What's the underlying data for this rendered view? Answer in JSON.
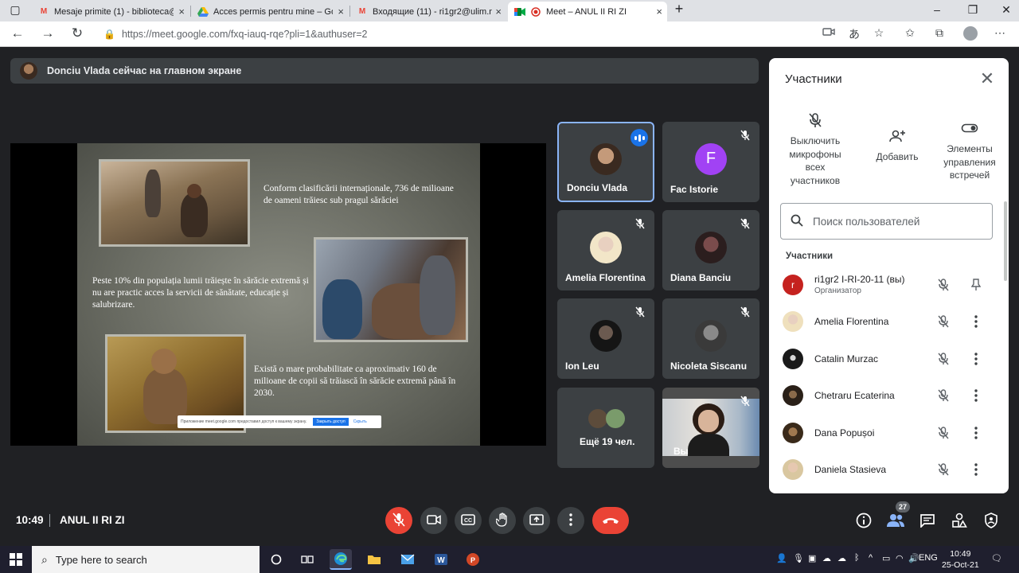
{
  "browser": {
    "tabs": [
      {
        "title": "Mesaje primite (1) - biblioteca@",
        "icon": "gmail-icon"
      },
      {
        "title": "Acces permis pentru mine – Goo",
        "icon": "google-drive-icon"
      },
      {
        "title": "Входящие (11) - ri1gr2@ulim.md",
        "icon": "gmail-icon"
      },
      {
        "title": "Meet – ANUL II RI ZI",
        "icon": "google-meet-icon"
      }
    ],
    "url": "https://meet.google.com/fxq-iauq-rqe?pli=1&authuser=2"
  },
  "meeting": {
    "presenter_banner": "Donciu Vlada сейчас на главном экране",
    "time": "10:49",
    "name": "ANUL II RI ZI"
  },
  "slide": {
    "text1": "Conform clasificării internaționale, 736 de milioane de oameni trăiesc sub pragul sărăciei",
    "text2": "Peste 10% din populația lumii trăiește în sărăcie extremă și nu are practic acces la servicii de sănătate, educație și salubrizare.",
    "text3": "Există o mare probabilitate ca aproximativ 160 de milioane de copii să trăiască în sărăcie extremă până în 2030.",
    "share_notice": "Приложение meet.google.com предоставил доступ к вашему экрану.",
    "share_stop": "Закрыть доступ",
    "share_hide": "Скрыть"
  },
  "tiles": [
    {
      "name": "Donciu Vlada",
      "state": "speaking"
    },
    {
      "name": "Fac Istorie",
      "initial": "F",
      "color": "#a142f4"
    },
    {
      "name": "Amelia Florentina"
    },
    {
      "name": "Diana Banciu"
    },
    {
      "name": "Ion Leu"
    },
    {
      "name": "Nicoleta Siscanu"
    },
    {
      "name": "Ещё 19 чел."
    },
    {
      "name": "Вы"
    }
  ],
  "panel": {
    "title": "Участники",
    "actions": {
      "mute_all": "Выключить микрофоны всех участников",
      "add": "Добавить",
      "controls": "Элементы управления встречей"
    },
    "search_placeholder": "Поиск пользователей",
    "section_label": "Участники",
    "participants": [
      {
        "name": "ri1gr2 I-RI-20-11 (вы)",
        "role": "Организатор",
        "initial": "r",
        "color": "#d93025"
      },
      {
        "name": "Amelia Florentina"
      },
      {
        "name": "Catalin Murzac"
      },
      {
        "name": "Chetraru Ecaterina"
      },
      {
        "name": "Dana Popușoi"
      },
      {
        "name": "Daniela Stasieva"
      }
    ]
  },
  "controls": {
    "participants_count": "27"
  },
  "taskbar": {
    "search_placeholder": "Type here to search",
    "language": "ENG",
    "clock_time": "10:49",
    "clock_date": "25-Oct-21"
  }
}
